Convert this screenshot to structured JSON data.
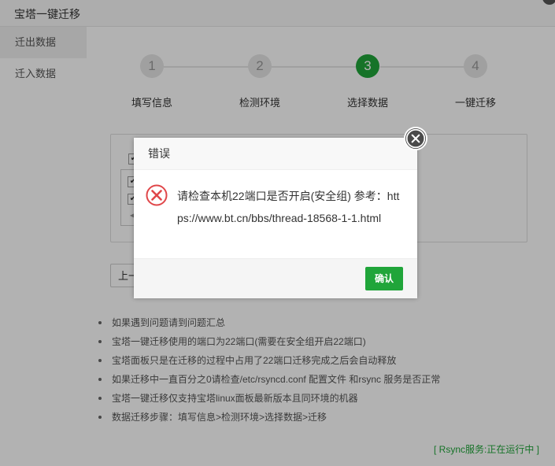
{
  "window": {
    "title": "宝塔一键迁移"
  },
  "sidebar": {
    "items": [
      {
        "label": "迁出数据"
      },
      {
        "label": "迁入数据"
      }
    ]
  },
  "steps": [
    {
      "num": "1",
      "label": "填写信息"
    },
    {
      "num": "2",
      "label": "检测环境"
    },
    {
      "num": "3",
      "label": "选择数据"
    },
    {
      "num": "4",
      "label": "一键迁移"
    }
  ],
  "active_step": 3,
  "prev_button": {
    "label": "上一"
  },
  "tips": [
    "如果遇到问题请到问题汇总",
    "宝塔一键迁移使用的端口为22端口(需要在安全组开启22端口)",
    "宝塔面板只是在迁移的过程中占用了22端口迁移完成之后会自动释放",
    "如果迁移中一直百分之0请检查/etc/rsyncd.conf 配置文件 和rsync 服务是否正常",
    "宝塔一键迁移仅支持宝塔linux面板最新版本且同环境的机器",
    "数据迁移步骤：填写信息>检测环境>选择数据>迁移"
  ],
  "footer": {
    "status": "[ Rsync服务:正在运行中 ]"
  },
  "dialog": {
    "title": "错误",
    "message": "请检查本机22端口是否开启(安全组) 参考：https://www.bt.cn/bbs/thread-18568-1-1.html",
    "ok_label": "确认"
  },
  "icons": {
    "close": "close-icon",
    "error": "error-icon"
  },
  "colors": {
    "accent": "#20a53a",
    "error": "#e0474a"
  }
}
